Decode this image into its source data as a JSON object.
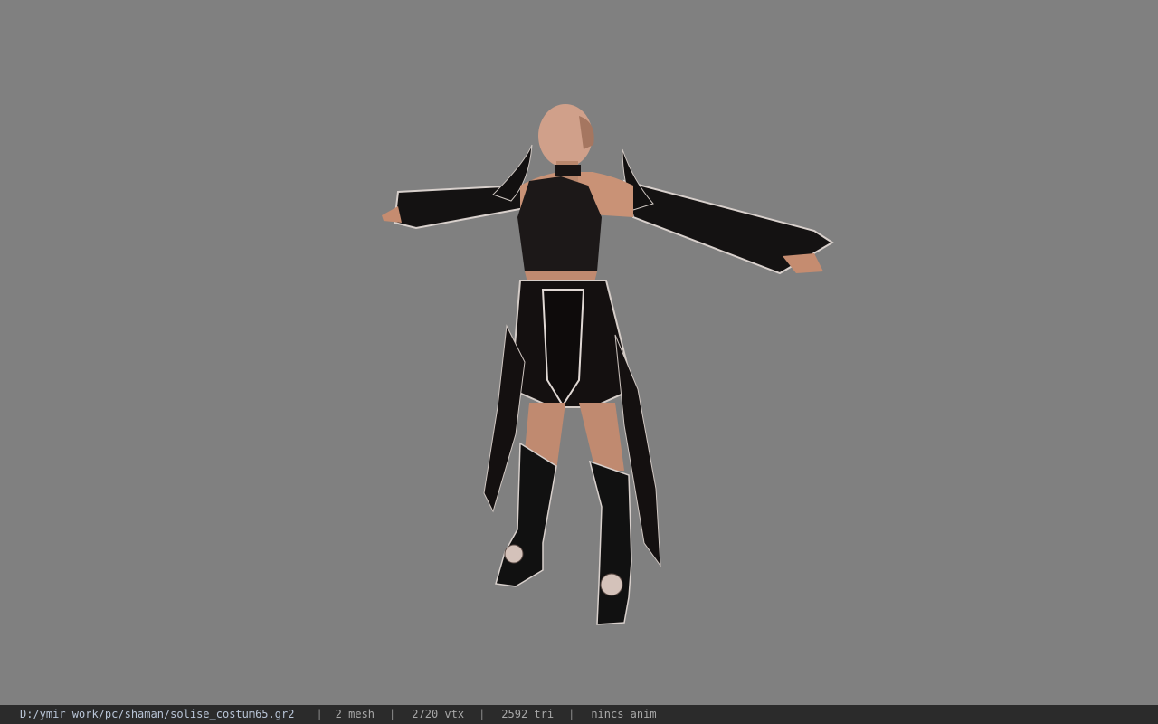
{
  "viewer": {
    "background_color": "#808080"
  },
  "status_bar": {
    "file_path": "D:/ymir work/pc/shaman/solise_costum65.gr2",
    "separator": "|",
    "mesh_count": "2 mesh",
    "vertex_count": "2720 vtx",
    "triangle_count": "2592 tri",
    "animation": "nincs anim"
  }
}
